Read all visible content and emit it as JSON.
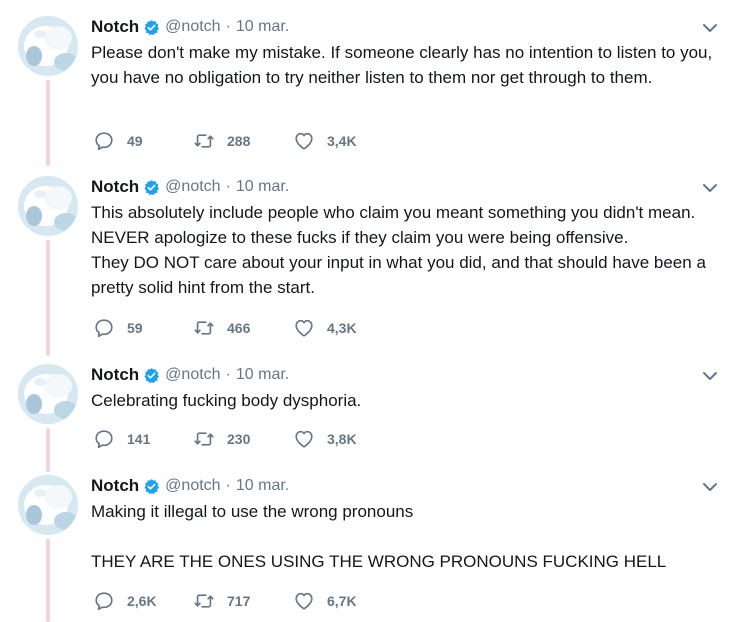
{
  "tweets": [
    {
      "author": {
        "name": "Notch",
        "handle": "@notch",
        "verified": true
      },
      "date": "10 mar.",
      "text": "Please don't make my mistake. If someone clearly has no intention to listen to you, you have no obligation to try neither listen to them nor get through to them.",
      "replies": "49",
      "retweets": "288",
      "likes": "3,4K"
    },
    {
      "author": {
        "name": "Notch",
        "handle": "@notch",
        "verified": true
      },
      "date": "10 mar.",
      "text": "This absolutely include people who claim you meant something you didn't mean. NEVER apologize to these fucks if they claim you were being offensive.\nThey DO NOT care about your input in what you did, and that should have been a pretty solid hint from the start.",
      "replies": "59",
      "retweets": "466",
      "likes": "4,3K"
    },
    {
      "author": {
        "name": "Notch",
        "handle": "@notch",
        "verified": true
      },
      "date": "10 mar.",
      "text": "Celebrating fucking body dysphoria.",
      "replies": "141",
      "retweets": "230",
      "likes": "3,8K"
    },
    {
      "author": {
        "name": "Notch",
        "handle": "@notch",
        "verified": true
      },
      "date": "10 mar.",
      "text": "Making it illegal to use the wrong pronouns\n\nTHEY ARE THE ONES USING THE WRONG PRONOUNS FUCKING HELL",
      "replies": "2,6K",
      "retweets": "717",
      "likes": "6,7K"
    }
  ],
  "icons": {
    "verified": "verified-badge-icon",
    "caret": "chevron-down-icon",
    "reply": "reply-icon",
    "retweet": "retweet-icon",
    "like": "heart-icon",
    "avatar": "profile-avatar"
  },
  "colors": {
    "text": "#14171a",
    "muted": "#657786",
    "verified": "#1da1f2",
    "thread_line": "#f7cfe0"
  }
}
